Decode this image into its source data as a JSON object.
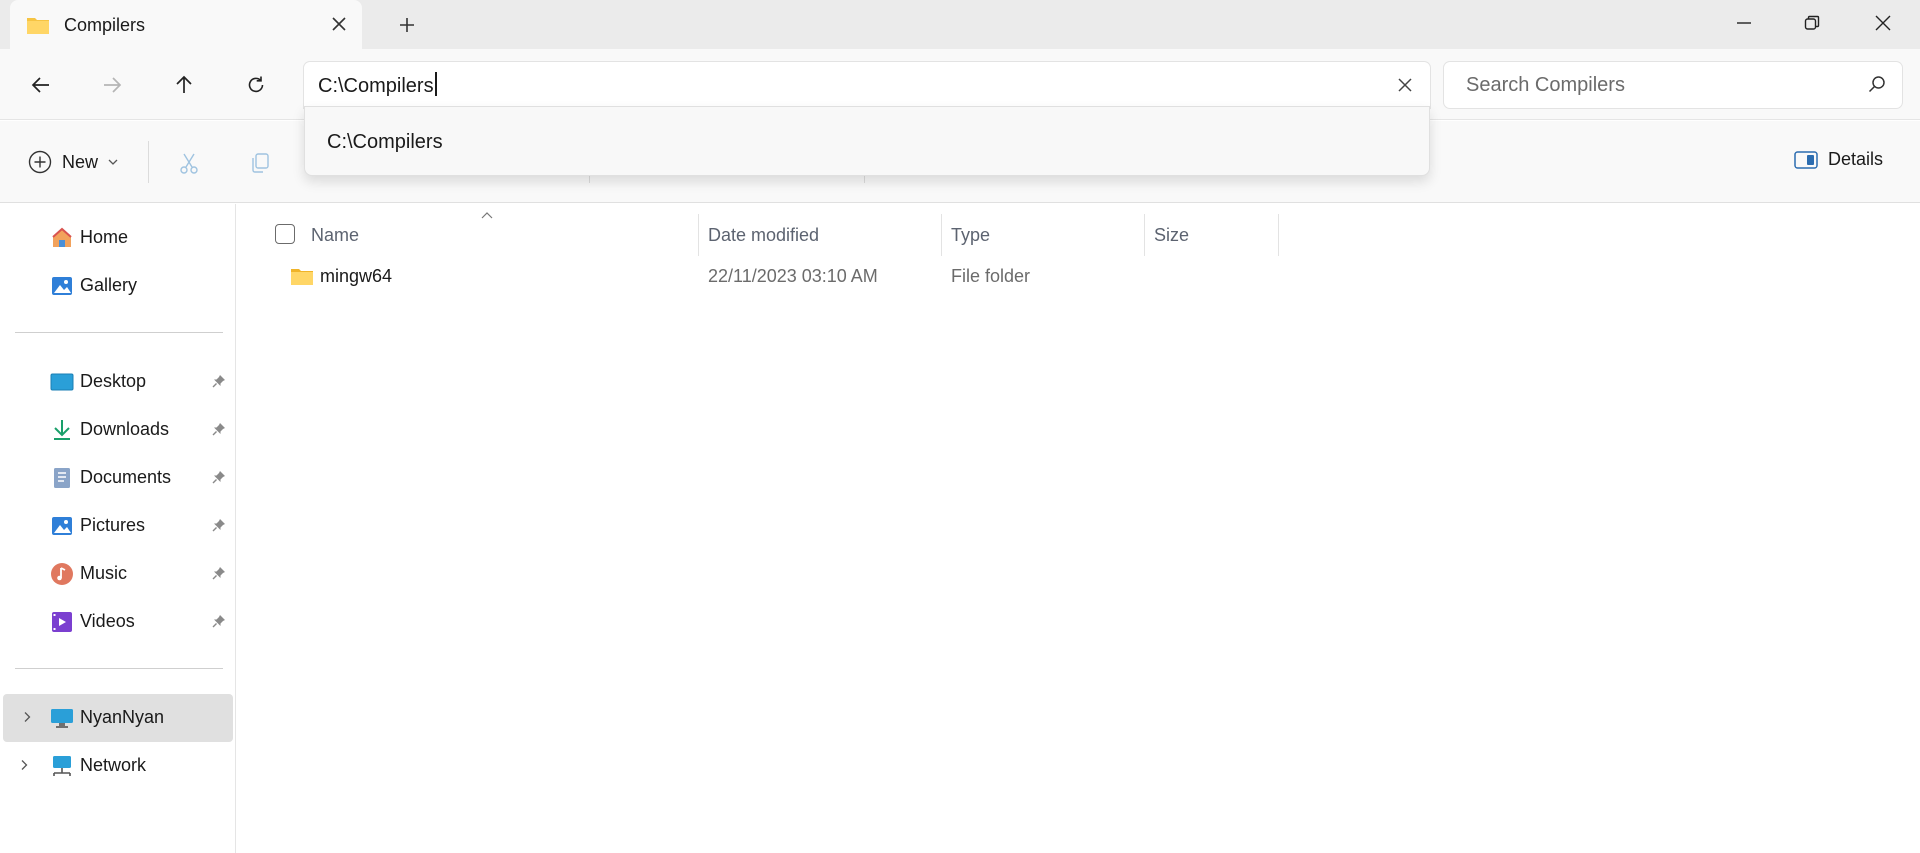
{
  "window": {
    "tab_title": "Compilers",
    "colors": {
      "accent_underline": "#a4262c",
      "folder": "#f6c443",
      "selected_bg": "#e0e0e0"
    }
  },
  "address_bar": {
    "value": "C:\\Compilers"
  },
  "search": {
    "placeholder": "Search Compilers"
  },
  "suggestion": {
    "items": [
      "C:\\Compilers"
    ]
  },
  "toolbar": {
    "new_label": "New",
    "details_label": "Details"
  },
  "sidebar": {
    "quick": [
      {
        "label": "Home",
        "icon": "home-icon"
      },
      {
        "label": "Gallery",
        "icon": "gallery-icon"
      }
    ],
    "pinned": [
      {
        "label": "Desktop",
        "icon": "desktop-icon"
      },
      {
        "label": "Downloads",
        "icon": "downloads-icon"
      },
      {
        "label": "Documents",
        "icon": "documents-icon"
      },
      {
        "label": "Pictures",
        "icon": "pictures-icon"
      },
      {
        "label": "Music",
        "icon": "music-icon"
      },
      {
        "label": "Videos",
        "icon": "videos-icon"
      }
    ],
    "locations": [
      {
        "label": "NyanNyan",
        "icon": "computer-icon",
        "selected": true
      },
      {
        "label": "Network",
        "icon": "network-icon",
        "selected": false
      }
    ]
  },
  "file_list": {
    "columns": {
      "name": "Name",
      "date": "Date modified",
      "type": "Type",
      "size": "Size"
    },
    "rows": [
      {
        "name": "mingw64",
        "date": "22/11/2023 03:10 AM",
        "type": "File folder",
        "size": ""
      }
    ]
  }
}
